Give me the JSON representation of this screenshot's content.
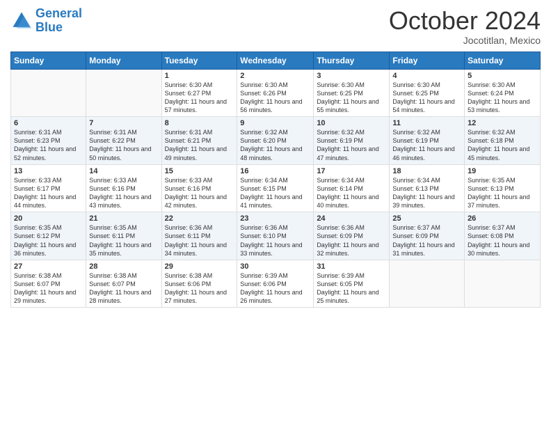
{
  "header": {
    "logo_line1": "General",
    "logo_line2": "Blue",
    "month_title": "October 2024",
    "subtitle": "Jocotitlan, Mexico"
  },
  "weekdays": [
    "Sunday",
    "Monday",
    "Tuesday",
    "Wednesday",
    "Thursday",
    "Friday",
    "Saturday"
  ],
  "weeks": [
    [
      {
        "day": "",
        "info": ""
      },
      {
        "day": "",
        "info": ""
      },
      {
        "day": "1",
        "info": "Sunrise: 6:30 AM\nSunset: 6:27 PM\nDaylight: 11 hours and 57 minutes."
      },
      {
        "day": "2",
        "info": "Sunrise: 6:30 AM\nSunset: 6:26 PM\nDaylight: 11 hours and 56 minutes."
      },
      {
        "day": "3",
        "info": "Sunrise: 6:30 AM\nSunset: 6:25 PM\nDaylight: 11 hours and 55 minutes."
      },
      {
        "day": "4",
        "info": "Sunrise: 6:30 AM\nSunset: 6:25 PM\nDaylight: 11 hours and 54 minutes."
      },
      {
        "day": "5",
        "info": "Sunrise: 6:30 AM\nSunset: 6:24 PM\nDaylight: 11 hours and 53 minutes."
      }
    ],
    [
      {
        "day": "6",
        "info": "Sunrise: 6:31 AM\nSunset: 6:23 PM\nDaylight: 11 hours and 52 minutes."
      },
      {
        "day": "7",
        "info": "Sunrise: 6:31 AM\nSunset: 6:22 PM\nDaylight: 11 hours and 50 minutes."
      },
      {
        "day": "8",
        "info": "Sunrise: 6:31 AM\nSunset: 6:21 PM\nDaylight: 11 hours and 49 minutes."
      },
      {
        "day": "9",
        "info": "Sunrise: 6:32 AM\nSunset: 6:20 PM\nDaylight: 11 hours and 48 minutes."
      },
      {
        "day": "10",
        "info": "Sunrise: 6:32 AM\nSunset: 6:19 PM\nDaylight: 11 hours and 47 minutes."
      },
      {
        "day": "11",
        "info": "Sunrise: 6:32 AM\nSunset: 6:19 PM\nDaylight: 11 hours and 46 minutes."
      },
      {
        "day": "12",
        "info": "Sunrise: 6:32 AM\nSunset: 6:18 PM\nDaylight: 11 hours and 45 minutes."
      }
    ],
    [
      {
        "day": "13",
        "info": "Sunrise: 6:33 AM\nSunset: 6:17 PM\nDaylight: 11 hours and 44 minutes."
      },
      {
        "day": "14",
        "info": "Sunrise: 6:33 AM\nSunset: 6:16 PM\nDaylight: 11 hours and 43 minutes."
      },
      {
        "day": "15",
        "info": "Sunrise: 6:33 AM\nSunset: 6:16 PM\nDaylight: 11 hours and 42 minutes."
      },
      {
        "day": "16",
        "info": "Sunrise: 6:34 AM\nSunset: 6:15 PM\nDaylight: 11 hours and 41 minutes."
      },
      {
        "day": "17",
        "info": "Sunrise: 6:34 AM\nSunset: 6:14 PM\nDaylight: 11 hours and 40 minutes."
      },
      {
        "day": "18",
        "info": "Sunrise: 6:34 AM\nSunset: 6:13 PM\nDaylight: 11 hours and 39 minutes."
      },
      {
        "day": "19",
        "info": "Sunrise: 6:35 AM\nSunset: 6:13 PM\nDaylight: 11 hours and 37 minutes."
      }
    ],
    [
      {
        "day": "20",
        "info": "Sunrise: 6:35 AM\nSunset: 6:12 PM\nDaylight: 11 hours and 36 minutes."
      },
      {
        "day": "21",
        "info": "Sunrise: 6:35 AM\nSunset: 6:11 PM\nDaylight: 11 hours and 35 minutes."
      },
      {
        "day": "22",
        "info": "Sunrise: 6:36 AM\nSunset: 6:11 PM\nDaylight: 11 hours and 34 minutes."
      },
      {
        "day": "23",
        "info": "Sunrise: 6:36 AM\nSunset: 6:10 PM\nDaylight: 11 hours and 33 minutes."
      },
      {
        "day": "24",
        "info": "Sunrise: 6:36 AM\nSunset: 6:09 PM\nDaylight: 11 hours and 32 minutes."
      },
      {
        "day": "25",
        "info": "Sunrise: 6:37 AM\nSunset: 6:09 PM\nDaylight: 11 hours and 31 minutes."
      },
      {
        "day": "26",
        "info": "Sunrise: 6:37 AM\nSunset: 6:08 PM\nDaylight: 11 hours and 30 minutes."
      }
    ],
    [
      {
        "day": "27",
        "info": "Sunrise: 6:38 AM\nSunset: 6:07 PM\nDaylight: 11 hours and 29 minutes."
      },
      {
        "day": "28",
        "info": "Sunrise: 6:38 AM\nSunset: 6:07 PM\nDaylight: 11 hours and 28 minutes."
      },
      {
        "day": "29",
        "info": "Sunrise: 6:38 AM\nSunset: 6:06 PM\nDaylight: 11 hours and 27 minutes."
      },
      {
        "day": "30",
        "info": "Sunrise: 6:39 AM\nSunset: 6:06 PM\nDaylight: 11 hours and 26 minutes."
      },
      {
        "day": "31",
        "info": "Sunrise: 6:39 AM\nSunset: 6:05 PM\nDaylight: 11 hours and 25 minutes."
      },
      {
        "day": "",
        "info": ""
      },
      {
        "day": "",
        "info": ""
      }
    ]
  ]
}
